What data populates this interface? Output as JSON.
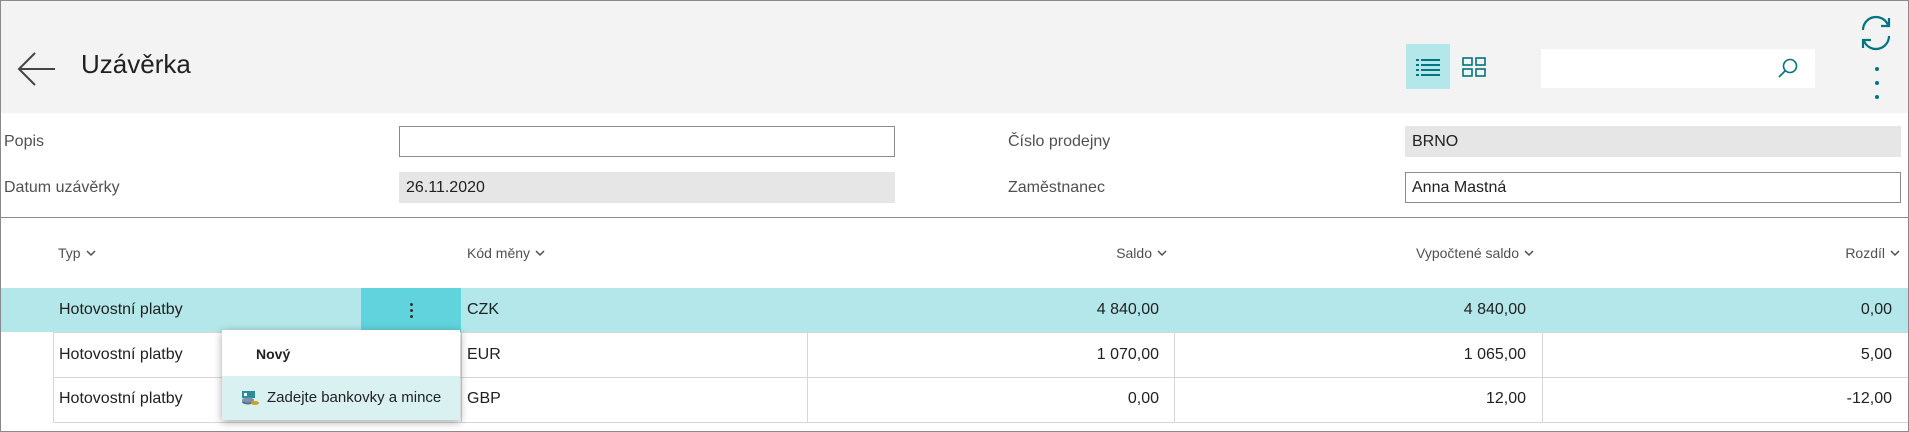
{
  "header": {
    "title": "Uzávěrka",
    "search": {
      "value": "",
      "placeholder": ""
    },
    "icons": {
      "back": "back-arrow-icon",
      "list_view": "list-view-icon",
      "tile_view": "tile-view-icon",
      "search": "search-icon",
      "refresh": "refresh-icon",
      "more": "more-options-icon"
    },
    "accent_color": "#00747f"
  },
  "form": {
    "popis": {
      "label": "Popis",
      "value": ""
    },
    "datum_uzaverky": {
      "label": "Datum uzávěrky",
      "value": "26.11.2020"
    },
    "cislo_prodejny": {
      "label": "Číslo prodejny",
      "value": "BRNO"
    },
    "zamestnanec": {
      "label": "Zaměstnanec",
      "value": "Anna Mastná"
    }
  },
  "table": {
    "columns": {
      "typ": "Typ",
      "kod_meny": "Kód měny",
      "saldo": "Saldo",
      "vypoctene_saldo": "Vypočtené saldo",
      "rozdil": "Rozdíl"
    },
    "rows": [
      {
        "typ": "Hotovostní platby",
        "kod_meny": "CZK",
        "saldo": "4 840,00",
        "vypoctene_saldo": "4 840,00",
        "rozdil": "0,00",
        "selected": true
      },
      {
        "typ": "Hotovostní platby",
        "kod_meny": "EUR",
        "saldo": "1 070,00",
        "vypoctene_saldo": "1 065,00",
        "rozdil": "5,00",
        "selected": false
      },
      {
        "typ": "Hotovostní platby",
        "kod_meny": "GBP",
        "saldo": "0,00",
        "vypoctene_saldo": "12,00",
        "rozdil": "-12,00",
        "selected": false
      }
    ],
    "selected_row_color": "#b3e7ea"
  },
  "context_menu": {
    "header": "Nový",
    "items": [
      {
        "label": "Zadejte bankovky a mince",
        "icon": "banknotes-coins-icon"
      }
    ]
  }
}
